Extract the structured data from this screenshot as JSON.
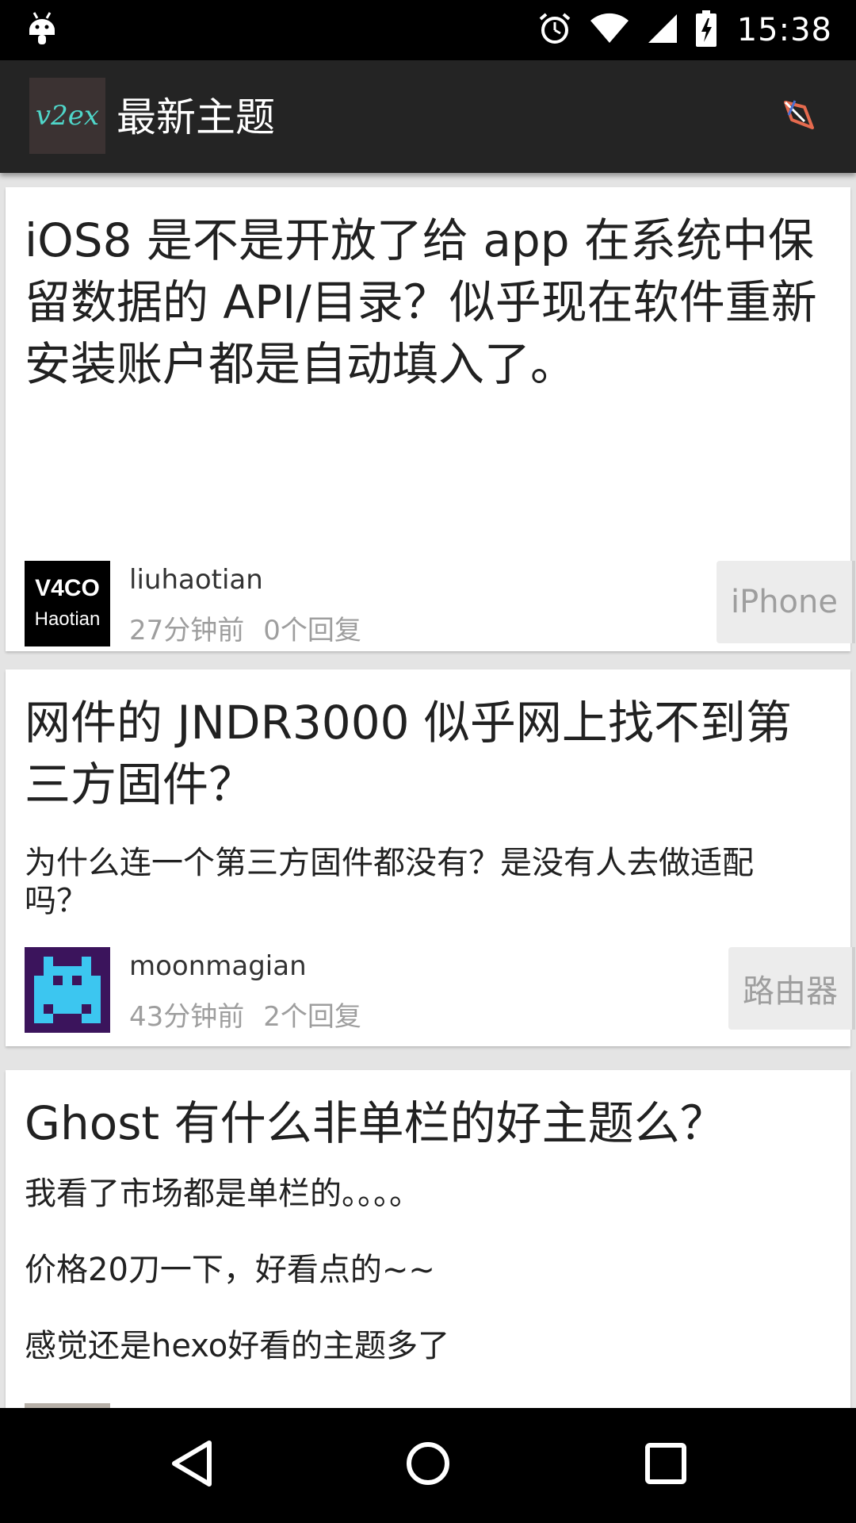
{
  "status_bar": {
    "time": "15:38",
    "icons": [
      "android-icon",
      "alarm-icon",
      "wifi-icon",
      "signal-icon",
      "battery-charging-icon"
    ]
  },
  "app_bar": {
    "logo_text": "v2ex",
    "title": "最新主题",
    "action_icon": "share-icon"
  },
  "topics": [
    {
      "title": "iOS8 是不是开放了给 app 在系统中保留数据的 API/目录？似乎现在软件重新安装账户都是自动填入了。",
      "content": [],
      "author": "liuhaotian",
      "time": "27分钟前",
      "replies": "0个回复",
      "node": "iPhone",
      "avatar_line1": "V4CO",
      "avatar_line2": "Haotian"
    },
    {
      "title": "网件的 JNDR3000 似乎网上找不到第三方固件？",
      "content": [
        "为什么连一个第三方固件都没有？是没有人去做适配吗？"
      ],
      "author": "moonmagian",
      "time": "43分钟前",
      "replies": "2个回复",
      "node": "路由器"
    },
    {
      "title": "Ghost 有什么非单栏的好主题么？",
      "content": [
        "我看了市场都是单栏的。。。。",
        "价格20刀一下，好看点的~~",
        "感觉还是hexo好看的主题多了"
      ]
    }
  ],
  "nav_bar": {
    "icons": [
      "back-icon",
      "home-icon",
      "recents-icon"
    ]
  },
  "colors": {
    "status_bar": "#000000",
    "app_bar": "#242424",
    "logo_text": "#4fd6c9",
    "background": "#e4e4e4",
    "card": "#ffffff",
    "muted_text": "#9e9e9e",
    "node_bg": "#ececec"
  }
}
